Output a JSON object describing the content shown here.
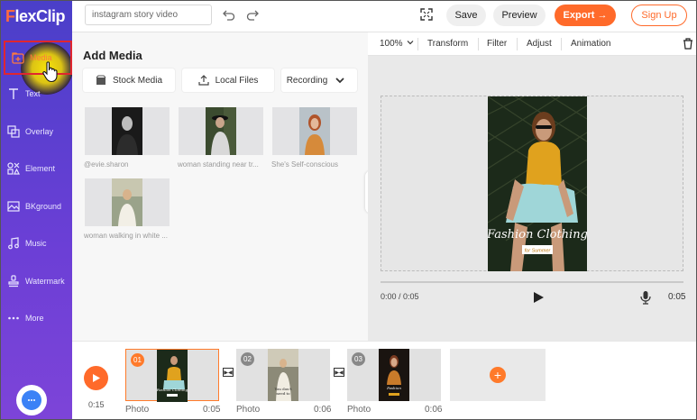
{
  "app": {
    "logo_f": "F",
    "logo_rest": "lexClip"
  },
  "sidebar": {
    "items": [
      {
        "label": "Media",
        "icon": "add-media-icon"
      },
      {
        "label": "Text",
        "icon": "text-icon"
      },
      {
        "label": "Overlay",
        "icon": "overlay-icon"
      },
      {
        "label": "Element",
        "icon": "element-icon"
      },
      {
        "label": "BKground",
        "icon": "background-icon"
      },
      {
        "label": "Music",
        "icon": "music-icon"
      },
      {
        "label": "Watermark",
        "icon": "watermark-icon"
      },
      {
        "label": "More",
        "icon": "more-icon"
      }
    ]
  },
  "topbar": {
    "search_value": "instagram story video",
    "save": "Save",
    "preview": "Preview",
    "export": "Export →",
    "signup": "Sign Up"
  },
  "panel": {
    "title": "Add Media",
    "tabs": {
      "stock": "Stock Media",
      "local": "Local Files",
      "recording": "Recording"
    },
    "thumbs": [
      {
        "caption": "@evie.sharon"
      },
      {
        "caption": "woman standing near tr..."
      },
      {
        "caption": "She's Self-conscious"
      },
      {
        "caption": "woman walking in white ..."
      }
    ]
  },
  "preview": {
    "zoom": "100%",
    "tools": {
      "transform": "Transform",
      "filter": "Filter",
      "adjust": "Adjust",
      "animation": "Animation"
    },
    "story_title": "Fashion Clothing",
    "story_sub": "for Summer",
    "time_current": "0:00 / 0:05",
    "time_total": "0:05"
  },
  "timeline": {
    "total": "0:15",
    "clips": [
      {
        "num": "01",
        "label": "Photo",
        "dur": "0:05"
      },
      {
        "num": "02",
        "label": "Photo",
        "dur": "0:06"
      },
      {
        "num": "03",
        "label": "Photo",
        "dur": "0:06"
      }
    ]
  },
  "colors": {
    "accent": "#ff6a2a",
    "sidebar_top": "#4a3fc9",
    "sidebar_bottom": "#7d44d8",
    "highlight": "#e0262f"
  }
}
